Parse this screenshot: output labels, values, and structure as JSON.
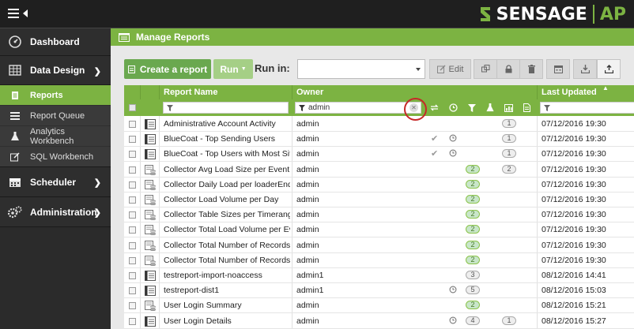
{
  "brand": {
    "name": "SENSAGE",
    "product": "AP",
    "accent": "#7cb342"
  },
  "sidebar": {
    "items": [
      {
        "label": "Dashboard",
        "icon": "dashboard-gauge-icon"
      },
      {
        "label": "Data Design",
        "icon": "table-grid-icon",
        "expanded": true
      },
      {
        "label": "Scheduler",
        "icon": "calendar-icon"
      },
      {
        "label": "Administration",
        "icon": "gears-icon"
      }
    ],
    "sub": [
      {
        "label": "Reports",
        "icon": "document-icon",
        "active": true
      },
      {
        "label": "Report Queue",
        "icon": "queue-icon"
      },
      {
        "label": "Analytics Workbench",
        "icon": "flask-icon"
      },
      {
        "label": "SQL Workbench",
        "icon": "edit-icon"
      }
    ]
  },
  "panel": {
    "title": "Manage Reports"
  },
  "toolbar": {
    "create_label": "Create a report",
    "run_label": "Run",
    "run_in_label": "Run in:",
    "run_in_value": "",
    "edit_label": "Edit"
  },
  "grid": {
    "columns": {
      "name": "Report Name",
      "owner": "Owner",
      "updated": "Last Updated"
    },
    "owner_filter": "admin",
    "rows": [
      {
        "name": "Administrative Account Activity",
        "owner": "admin",
        "check": false,
        "clock": false,
        "green": "",
        "grey": "1",
        "updated": "07/12/2016 19:30",
        "icon": "report-icon"
      },
      {
        "name": "BlueCoat - Top Sending Users",
        "owner": "admin",
        "check": true,
        "clock": true,
        "green": "",
        "grey": "1",
        "updated": "07/12/2016 19:30",
        "icon": "report-icon"
      },
      {
        "name": "BlueCoat - Top Users with Most Sit...",
        "owner": "admin",
        "check": true,
        "clock": true,
        "green": "",
        "grey": "1",
        "updated": "07/12/2016 19:30",
        "icon": "report-icon"
      },
      {
        "name": "Collector Avg Load Size per Event ...",
        "owner": "admin",
        "check": false,
        "clock": false,
        "green": "2",
        "grey": "2",
        "updated": "07/12/2016 19:30",
        "icon": "report-db-icon"
      },
      {
        "name": "Collector Daily Load per loaderEnd ...",
        "owner": "admin",
        "check": false,
        "clock": false,
        "green": "2",
        "grey": "",
        "updated": "07/12/2016 19:30",
        "icon": "report-db-icon"
      },
      {
        "name": "Collector Load Volume per Day",
        "owner": "admin",
        "check": false,
        "clock": false,
        "green": "2",
        "grey": "",
        "updated": "07/12/2016 19:30",
        "icon": "report-db-icon"
      },
      {
        "name": "Collector Table Sizes per Timerange",
        "owner": "admin",
        "check": false,
        "clock": false,
        "green": "2",
        "grey": "",
        "updated": "07/12/2016 19:30",
        "icon": "report-db-icon"
      },
      {
        "name": "Collector Total Load Volume per Ev...",
        "owner": "admin",
        "check": false,
        "clock": false,
        "green": "2",
        "grey": "",
        "updated": "07/12/2016 19:30",
        "icon": "report-db-icon"
      },
      {
        "name": "Collector Total Number of Records ...",
        "owner": "admin",
        "check": false,
        "clock": false,
        "green": "2",
        "grey": "",
        "updated": "07/12/2016 19:30",
        "icon": "report-db-icon"
      },
      {
        "name": "Collector Total Number of Records ...",
        "owner": "admin",
        "check": false,
        "clock": false,
        "green": "2",
        "grey": "",
        "updated": "07/12/2016 19:30",
        "icon": "report-db-icon"
      },
      {
        "name": "testreport-import-noaccess",
        "owner": "admin1",
        "check": false,
        "clock": false,
        "green": "",
        "grey3": "3",
        "grey": "",
        "updated": "08/12/2016 14:41",
        "icon": "report-icon"
      },
      {
        "name": "testreport-dist1",
        "owner": "admin1",
        "check": false,
        "clock": true,
        "green": "",
        "grey3": "5",
        "grey": "",
        "updated": "08/12/2016 15:03",
        "icon": "report-icon"
      },
      {
        "name": "User Login Summary",
        "owner": "admin",
        "check": false,
        "clock": false,
        "green": "2",
        "grey": "",
        "updated": "08/12/2016 15:21",
        "icon": "report-db-icon"
      },
      {
        "name": "User Login Details",
        "owner": "admin",
        "check": false,
        "clock": true,
        "green": "",
        "grey3": "4",
        "grey": "1",
        "updated": "08/12/2016 15:27",
        "icon": "report-icon"
      }
    ]
  }
}
